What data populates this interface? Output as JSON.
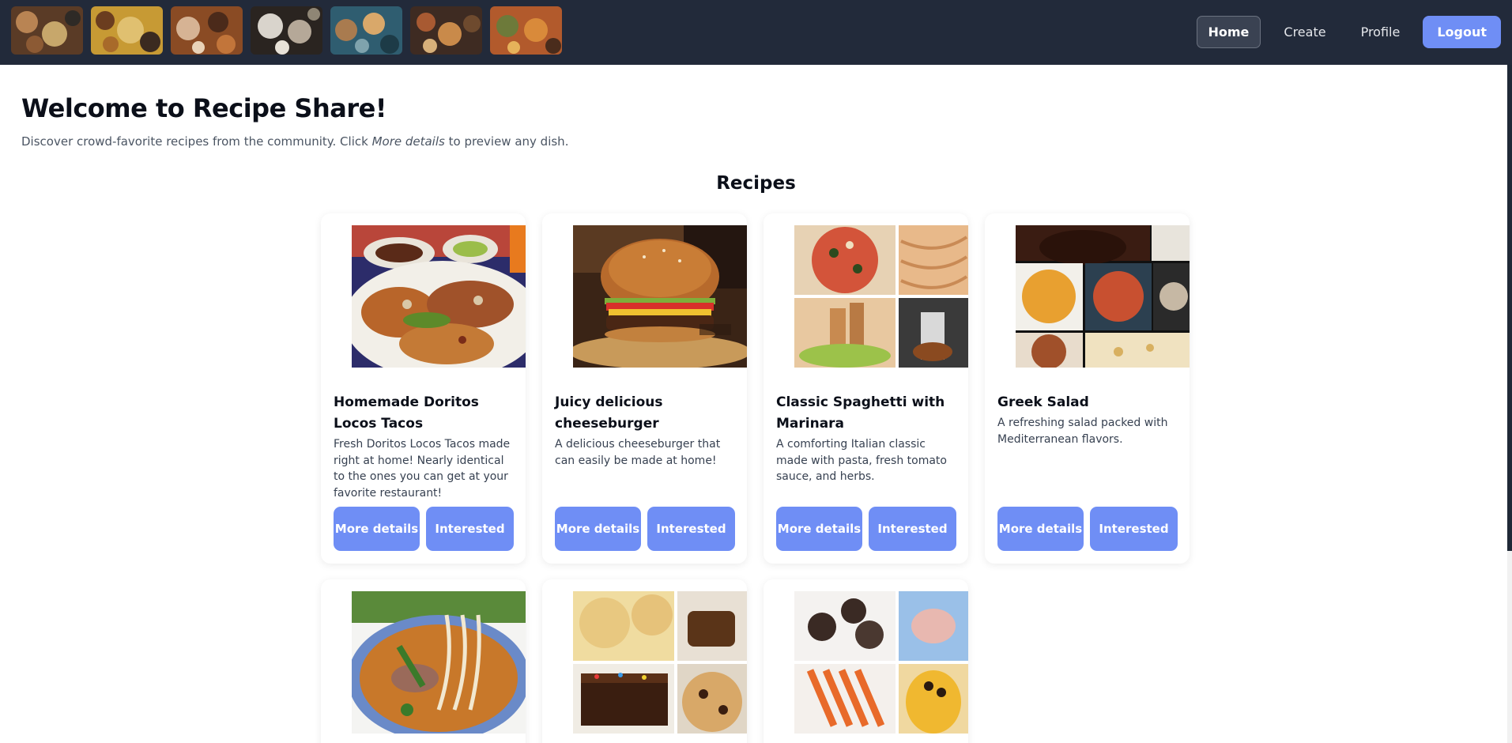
{
  "header": {
    "banner_thumbnails": [
      {
        "alt": "table-spread-1",
        "colors": [
          "#5a3b26",
          "#b98453",
          "#2e2a26",
          "#c7a76b"
        ]
      },
      {
        "alt": "table-spread-2",
        "colors": [
          "#c79a34",
          "#6b3d1f",
          "#e0c070",
          "#3b2a20"
        ]
      },
      {
        "alt": "table-spread-3",
        "colors": [
          "#8a4b24",
          "#d6b394",
          "#4b2a1a",
          "#c2753a"
        ]
      },
      {
        "alt": "table-spread-4",
        "colors": [
          "#d9d4cc",
          "#2a2420",
          "#8f8675",
          "#b5a898"
        ]
      },
      {
        "alt": "table-spread-5",
        "colors": [
          "#2f5d70",
          "#a97b4f",
          "#1d3b47",
          "#d9a86a"
        ]
      },
      {
        "alt": "table-spread-6",
        "colors": [
          "#3e2b22",
          "#a85a32",
          "#6e4a2e",
          "#c98a4a"
        ]
      },
      {
        "alt": "table-spread-7",
        "colors": [
          "#b25a2c",
          "#6d7a3a",
          "#d98a3a",
          "#4a2c1c"
        ]
      }
    ],
    "nav": {
      "home": "Home",
      "create": "Create",
      "profile": "Profile",
      "logout": "Logout"
    }
  },
  "hero": {
    "title": "Welcome to Recipe Share!",
    "subtitle_before": "Discover crowd-favorite recipes from the community. Click ",
    "subtitle_em": "More details",
    "subtitle_after": " to preview any dish."
  },
  "recipes_heading": "Recipes",
  "recipes": [
    {
      "title": "Homemade Doritos Locos Tacos",
      "description": "Fresh Doritos Locos Tacos made right at home! Nearly identical to the ones you can get at your favorite restaurant!",
      "more_details": "More details",
      "interested": "Interested",
      "image": "tacos-photo"
    },
    {
      "title": "Juicy delicious cheeseburger",
      "description": "A delicious cheeseburger that can easily be made at home!",
      "more_details": "More details",
      "interested": "Interested",
      "image": "cheeseburger-photo"
    },
    {
      "title": "Classic Spaghetti with Marinara",
      "description": "A comforting Italian classic made with pasta, fresh tomato sauce, and herbs.",
      "more_details": "More details",
      "interested": "Interested",
      "image": "italian-collage-photo"
    },
    {
      "title": "Greek Salad",
      "description": "A refreshing salad packed with Mediterranean flavors.",
      "more_details": "More details",
      "interested": "Interested",
      "image": "food-collage-photo"
    },
    {
      "image": "pho-soup-photo"
    },
    {
      "image": "cookies-brownies-photo"
    },
    {
      "image": "snacks-collage-photo"
    }
  ],
  "colors": {
    "nav_bg": "#222a3a",
    "accent": "#6f8ef5",
    "text_dark": "#0b0f19",
    "text_muted": "#4b5563"
  }
}
